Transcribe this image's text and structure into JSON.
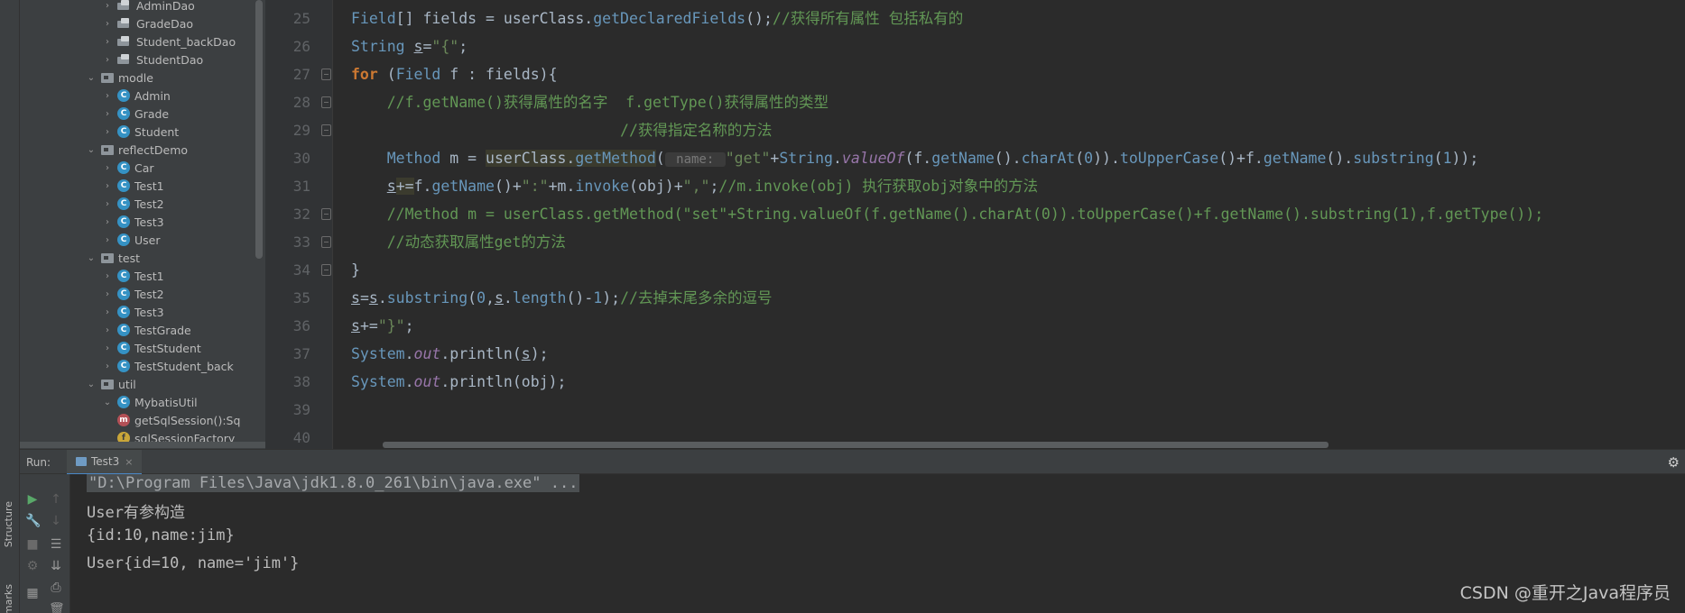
{
  "tool_strip": {
    "structure": "Structure",
    "bookmarks": "marks"
  },
  "project_tree": [
    {
      "label": "AdminDao",
      "icon": "dao",
      "indent": 2
    },
    {
      "label": "GradeDao",
      "icon": "dao",
      "indent": 2
    },
    {
      "label": "Student_backDao",
      "icon": "dao",
      "indent": 2
    },
    {
      "label": "StudentDao",
      "icon": "dao",
      "indent": 2
    },
    {
      "label": "modle",
      "icon": "folder",
      "indent": 1,
      "expanded": true
    },
    {
      "label": "Admin",
      "icon": "class",
      "indent": 2
    },
    {
      "label": "Grade",
      "icon": "class",
      "indent": 2
    },
    {
      "label": "Student",
      "icon": "class",
      "indent": 2
    },
    {
      "label": "reflectDemo",
      "icon": "folder",
      "indent": 1,
      "expanded": true
    },
    {
      "label": "Car",
      "icon": "class",
      "indent": 2
    },
    {
      "label": "Test1",
      "icon": "class",
      "indent": 2
    },
    {
      "label": "Test2",
      "icon": "class",
      "indent": 2
    },
    {
      "label": "Test3",
      "icon": "class",
      "indent": 2
    },
    {
      "label": "User",
      "icon": "class",
      "indent": 2
    },
    {
      "label": "test",
      "icon": "folder",
      "indent": 1,
      "expanded": true
    },
    {
      "label": "Test1",
      "icon": "class",
      "indent": 2
    },
    {
      "label": "Test2",
      "icon": "class",
      "indent": 2
    },
    {
      "label": "Test3",
      "icon": "class",
      "indent": 2
    },
    {
      "label": "TestGrade",
      "icon": "class",
      "indent": 2
    },
    {
      "label": "TestStudent",
      "icon": "class",
      "indent": 2
    },
    {
      "label": "TestStudent_back",
      "icon": "class",
      "indent": 2
    },
    {
      "label": "util",
      "icon": "folder",
      "indent": 1,
      "expanded": true
    },
    {
      "label": "MybatisUtil",
      "icon": "class",
      "indent": 2,
      "expanded": true
    },
    {
      "label": "getSqlSession():Sq",
      "icon": "method",
      "indent": 3
    },
    {
      "label": "sqlSessionFactory",
      "icon": "field",
      "indent": 3
    }
  ],
  "editor": {
    "line_numbers": [
      "25",
      "26",
      "27",
      "28",
      "29",
      "30",
      "31",
      "32",
      "33",
      "34",
      "35",
      "36",
      "37",
      "38",
      "39",
      "40"
    ],
    "lines": [
      [
        {
          "t": "Field",
          "c": "cls"
        },
        {
          "t": "[] fields = userClass.",
          "c": ""
        },
        {
          "t": "getDeclaredFields",
          "c": "cls"
        },
        {
          "t": "();",
          "c": ""
        },
        {
          "t": "//获得所有属性 包括私有的",
          "c": "cm"
        }
      ],
      [
        {
          "t": "String ",
          "c": "cls"
        },
        {
          "t": "s",
          "c": "ul"
        },
        {
          "t": "=",
          "c": ""
        },
        {
          "t": "\"{\"",
          "c": "str"
        },
        {
          "t": ";",
          "c": ""
        }
      ],
      [
        {
          "t": "for",
          "c": "kw"
        },
        {
          "t": " (",
          "c": ""
        },
        {
          "t": "Field",
          "c": "cls"
        },
        {
          "t": " f : fields){",
          "c": ""
        }
      ],
      [
        {
          "t": "    //f.getName()获得属性的名字  f.getType()获得属性的类型",
          "c": "cm"
        }
      ],
      [
        {
          "t": "                              //获得指定名称的方法",
          "c": "cm"
        }
      ],
      [
        {
          "t": "    ",
          "c": ""
        },
        {
          "t": "Method",
          "c": "cls"
        },
        {
          "t": " m = ",
          "c": ""
        },
        {
          "t": "userClass.",
          "c": "hl"
        },
        {
          "t": "getMethod",
          "c": "hl cls"
        },
        {
          "t": "(",
          "c": ""
        },
        {
          "t": " name: ",
          "c": "hint"
        },
        {
          "t": "\"get\"",
          "c": "str"
        },
        {
          "t": "+",
          "c": ""
        },
        {
          "t": "String",
          "c": "cls"
        },
        {
          "t": ".",
          "c": ""
        },
        {
          "t": "valueOf",
          "c": "st"
        },
        {
          "t": "(f.",
          "c": ""
        },
        {
          "t": "getName",
          "c": "cls"
        },
        {
          "t": "().",
          "c": ""
        },
        {
          "t": "charAt",
          "c": "cls"
        },
        {
          "t": "(",
          "c": ""
        },
        {
          "t": "0",
          "c": "num"
        },
        {
          "t": ")).",
          "c": ""
        },
        {
          "t": "toUpperCase",
          "c": "cls"
        },
        {
          "t": "()+f.",
          "c": ""
        },
        {
          "t": "getName",
          "c": "cls"
        },
        {
          "t": "().",
          "c": ""
        },
        {
          "t": "substring",
          "c": "cls"
        },
        {
          "t": "(",
          "c": ""
        },
        {
          "t": "1",
          "c": "num"
        },
        {
          "t": "));",
          "c": ""
        }
      ],
      [
        {
          "t": "    ",
          "c": ""
        },
        {
          "t": "s",
          "c": "ul"
        },
        {
          "t": "+=",
          "c": "hl"
        },
        {
          "t": "f.",
          "c": ""
        },
        {
          "t": "getName",
          "c": "cls"
        },
        {
          "t": "()+",
          "c": ""
        },
        {
          "t": "\":\"",
          "c": "str"
        },
        {
          "t": "+m.",
          "c": ""
        },
        {
          "t": "invoke",
          "c": "cls"
        },
        {
          "t": "(obj)+",
          "c": ""
        },
        {
          "t": "\",\"",
          "c": "str"
        },
        {
          "t": ";",
          "c": ""
        },
        {
          "t": "//m.invoke(obj) 执行获取obj对象中的方法",
          "c": "cm"
        }
      ],
      [
        {
          "t": "    //Method m = userClass.getMethod(\"set\"+String.valueOf(f.getName().charAt(0)).toUpperCase()+f.getName().substring(1),f.getType());",
          "c": "cm"
        }
      ],
      [
        {
          "t": "    //动态获取属性get的方法",
          "c": "cm"
        }
      ],
      [
        {
          "t": "}",
          "c": ""
        }
      ],
      [
        {
          "t": "s",
          "c": "ul"
        },
        {
          "t": "=",
          "c": ""
        },
        {
          "t": "s",
          "c": "ul"
        },
        {
          "t": ".",
          "c": ""
        },
        {
          "t": "substring",
          "c": "cls"
        },
        {
          "t": "(",
          "c": ""
        },
        {
          "t": "0",
          "c": "num"
        },
        {
          "t": ",",
          "c": ""
        },
        {
          "t": "s",
          "c": "ul"
        },
        {
          "t": ".",
          "c": ""
        },
        {
          "t": "length",
          "c": "cls"
        },
        {
          "t": "()-",
          "c": ""
        },
        {
          "t": "1",
          "c": "num"
        },
        {
          "t": ");",
          "c": ""
        },
        {
          "t": "//去掉末尾多余的逗号",
          "c": "cm"
        }
      ],
      [
        {
          "t": "s",
          "c": "ul"
        },
        {
          "t": "+=",
          "c": ""
        },
        {
          "t": "\"}\"",
          "c": "str"
        },
        {
          "t": ";",
          "c": ""
        }
      ],
      [
        {
          "t": "System",
          "c": "cls"
        },
        {
          "t": ".",
          "c": ""
        },
        {
          "t": "out",
          "c": "st"
        },
        {
          "t": ".println(",
          "c": ""
        },
        {
          "t": "s",
          "c": "ul"
        },
        {
          "t": ");",
          "c": ""
        }
      ],
      [
        {
          "t": "System",
          "c": "cls"
        },
        {
          "t": ".",
          "c": ""
        },
        {
          "t": "out",
          "c": "st"
        },
        {
          "t": ".println(obj);",
          "c": ""
        }
      ],
      [
        {
          "t": "",
          "c": ""
        }
      ],
      [
        {
          "t": "",
          "c": ""
        }
      ]
    ]
  },
  "run_panel": {
    "label": "Run:",
    "tab": "Test3",
    "close": "×",
    "output": [
      "\"D:\\Program Files\\Java\\jdk1.8.0_261\\bin\\java.exe\" ...",
      "User有参构造",
      "{id:10,name:jim}",
      "User{id=10, name='jim'}"
    ]
  },
  "watermark": "CSDN @重开之Java程序员"
}
